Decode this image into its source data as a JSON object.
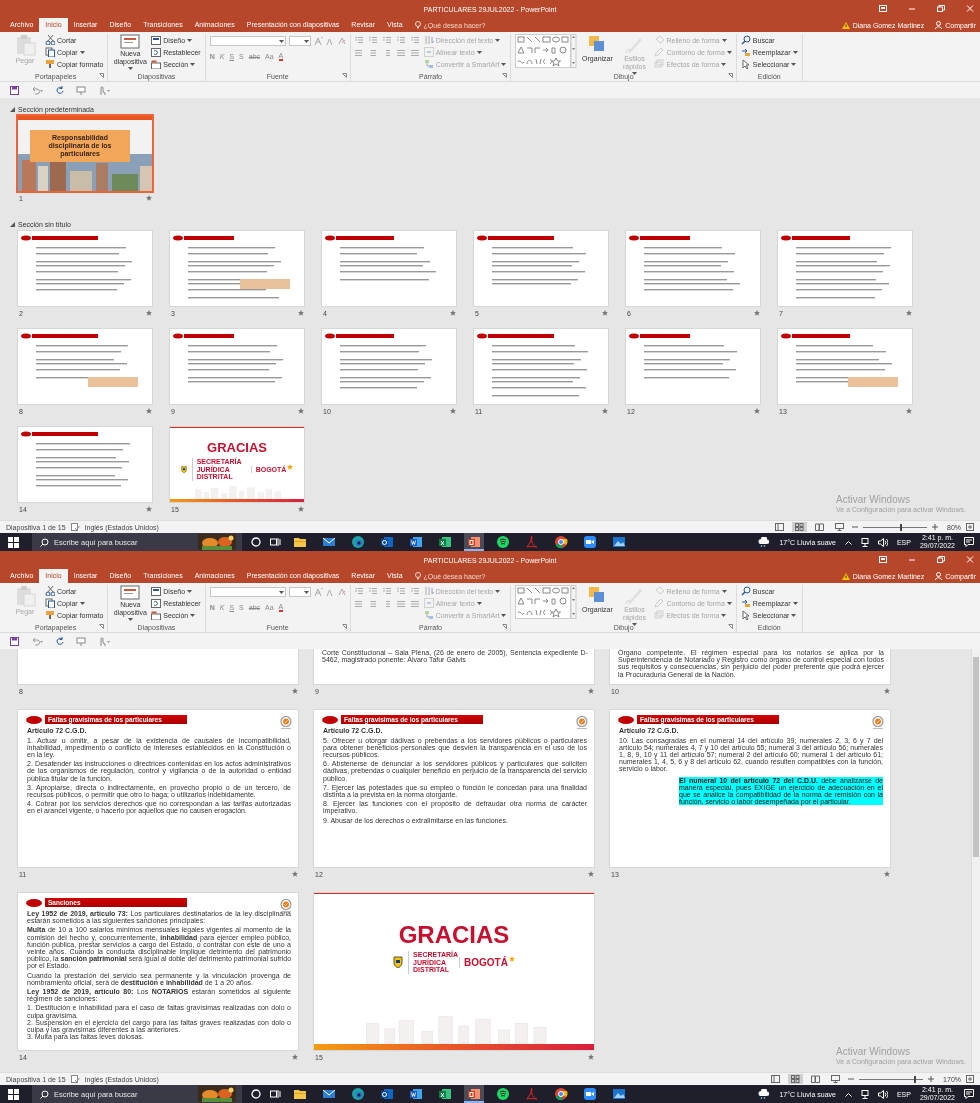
{
  "screens": [
    {
      "window": {
        "title": "PARTICULARES 29JUL2022 - PowerPoint",
        "tabs": [
          {
            "label": "Archivo",
            "selected": false
          },
          {
            "label": "Inicio",
            "selected": true
          },
          {
            "label": "Insertar",
            "selected": false
          },
          {
            "label": "Diseño",
            "selected": false
          },
          {
            "label": "Transiciones",
            "selected": false
          },
          {
            "label": "Animaciones",
            "selected": false
          },
          {
            "label": "Presentación con diapositivas",
            "selected": false
          },
          {
            "label": "Revisar",
            "selected": false
          },
          {
            "label": "Vista",
            "selected": false
          }
        ],
        "tell_me": {
          "placeholder": "¿Qué desea hacer?"
        },
        "user": "Diana Gomez Martinez",
        "share": "Compartir",
        "ribbon": [
          {
            "label": "Portapapeles",
            "launcher": true,
            "items": [
              {
                "kind": "large",
                "label": "Pegar",
                "disabled": true,
                "menu": false
              },
              {
                "kind": "small",
                "label": "Cortar",
                "disabled": false,
                "menu": false
              },
              {
                "kind": "small",
                "label": "Copiar",
                "disabled": false,
                "menu": true
              },
              {
                "kind": "small",
                "label": "Copiar formato",
                "disabled": false,
                "menu": false
              }
            ]
          },
          {
            "label": "Diapositivas",
            "launcher": false,
            "items": [
              {
                "kind": "large",
                "label": "Nueva diapositiva",
                "disabled": false,
                "menu": true
              },
              {
                "kind": "small",
                "label": "Diseño",
                "disabled": false,
                "menu": true
              },
              {
                "kind": "small",
                "label": "Restablecer",
                "disabled": false,
                "menu": false
              },
              {
                "kind": "small",
                "label": "Sección",
                "disabled": false,
                "menu": true
              }
            ]
          },
          {
            "label": "Fuente",
            "launcher": true,
            "items": [
              {
                "kind": "font-fields"
              },
              {
                "kind": "glyphs",
                "glyphs": [
                  {
                    "label": "N",
                    "disabled": true
                  },
                  {
                    "label": "K",
                    "disabled": true
                  },
                  {
                    "label": "S",
                    "disabled": true
                  },
                  {
                    "label": "S",
                    "disabled": true
                  },
                  {
                    "label": "abc",
                    "disabled": true
                  },
                  {
                    "label": "Aa",
                    "disabled": true
                  },
                  {
                    "label": "A",
                    "disabled": true
                  }
                ]
              }
            ]
          },
          {
            "label": "Párrafo",
            "launcher": true,
            "items": [
              {
                "kind": "paragraph-tools"
              },
              {
                "kind": "small",
                "label": "Dirección del texto",
                "disabled": true,
                "menu": true
              },
              {
                "kind": "small",
                "label": "Alinear texto",
                "disabled": true,
                "menu": true
              },
              {
                "kind": "small",
                "label": "Convertir a SmartArt",
                "disabled": true,
                "menu": true
              }
            ]
          },
          {
            "label": "Dibujo",
            "launcher": true,
            "items": [
              {
                "kind": "shapes"
              },
              {
                "kind": "large",
                "label": "Organizar",
                "disabled": false,
                "menu": false
              },
              {
                "kind": "large",
                "label": "Estilos rápidos",
                "disabled": true,
                "menu": true
              },
              {
                "kind": "small",
                "label": "Relleno de forma",
                "disabled": true,
                "menu": true
              },
              {
                "kind": "small",
                "label": "Contorno de forma",
                "disabled": true,
                "menu": true
              },
              {
                "kind": "small",
                "label": "Efectos de forma",
                "disabled": true,
                "menu": true
              }
            ]
          },
          {
            "label": "Edición",
            "launcher": false,
            "items": [
              {
                "kind": "small",
                "label": "Buscar",
                "disabled": false,
                "menu": false
              },
              {
                "kind": "small",
                "label": "Reemplazar",
                "disabled": false,
                "menu": true
              },
              {
                "kind": "small",
                "label": "Seleccionar",
                "disabled": false,
                "menu": true
              }
            ]
          }
        ],
        "sorter": {
          "kind": "thumbnails",
          "sections": [
            {
              "label": "Sección predeterminada",
              "expanded": true,
              "slides": [
                {
                  "number": "1",
                  "kind": "title",
                  "selected": true,
                  "title": "Responsabilidad disciplinaria de los particulares"
                }
              ]
            },
            {
              "label": "Sección sin título",
              "expanded": true,
              "slides": [
                {
                  "number": "2",
                  "kind": "thumb",
                  "selected": false
                },
                {
                  "number": "3",
                  "kind": "thumb",
                  "selected": false
                },
                {
                  "number": "4",
                  "kind": "thumb",
                  "selected": false
                },
                {
                  "number": "5",
                  "kind": "thumb",
                  "selected": false
                },
                {
                  "number": "6",
                  "kind": "thumb",
                  "selected": false
                },
                {
                  "number": "7",
                  "kind": "thumb",
                  "selected": false
                },
                {
                  "number": "8",
                  "kind": "thumb",
                  "selected": false
                },
                {
                  "number": "9",
                  "kind": "thumb",
                  "selected": false
                },
                {
                  "number": "10",
                  "kind": "thumb",
                  "selected": false
                },
                {
                  "number": "11",
                  "kind": "thumb",
                  "selected": false
                },
                {
                  "number": "12",
                  "kind": "thumb",
                  "selected": false
                },
                {
                  "number": "13",
                  "kind": "thumb",
                  "selected": false
                },
                {
                  "number": "14",
                  "kind": "thumb",
                  "selected": false
                },
                {
                  "number": "15",
                  "kind": "thanks",
                  "selected": false,
                  "title": "GRACIAS",
                  "org": "SECRETARÍA JURÍDICA DISTRITAL",
                  "city": "BOGOTÁ"
                }
              ]
            }
          ]
        },
        "activation": {
          "title": "Activar Windows",
          "text": "Ve a Configuración para activar Windows."
        },
        "status": {
          "slide": "Diapositiva 1 de 15",
          "language": "Inglés (Estados Unidos)",
          "views": [
            {
              "selected": false
            },
            {
              "selected": true
            },
            {
              "selected": false
            },
            {
              "selected": false
            }
          ],
          "zoom_slider": {
            "level": 0.6
          },
          "zoom": "80%"
        }
      },
      "taskbar": {
        "search": {
          "placeholder": "Escribe aquí para buscar"
        },
        "apps": [
          {
            "selected": false
          },
          {
            "selected": false
          },
          {
            "selected": false
          },
          {
            "selected": false
          },
          {
            "selected": false
          },
          {
            "selected": false
          },
          {
            "selected": true
          },
          {
            "selected": false
          },
          {
            "selected": false
          },
          {
            "selected": false
          },
          {
            "selected": false
          },
          {
            "selected": false
          }
        ],
        "weather": "17°C Lluvia suave",
        "lang": "ESP",
        "time": "2:41 p. m.",
        "date": "29/07/2022"
      }
    },
    {
      "window": {
        "title": "PARTICULARES 29JUL2022 - PowerPoint",
        "tabs": [
          {
            "label": "Archivo",
            "selected": false
          },
          {
            "label": "Inicio",
            "selected": true
          },
          {
            "label": "Insertar",
            "selected": false
          },
          {
            "label": "Diseño",
            "selected": false
          },
          {
            "label": "Transiciones",
            "selected": false
          },
          {
            "label": "Animaciones",
            "selected": false
          },
          {
            "label": "Presentación con diapositivas",
            "selected": false
          },
          {
            "label": "Revisar",
            "selected": false
          },
          {
            "label": "Vista",
            "selected": false
          }
        ],
        "tell_me": {
          "placeholder": "¿Qué desea hacer?"
        },
        "user": "Diana Gomez Martinez",
        "share": "Compartir",
        "ribbon": [
          {
            "label": "Portapapeles",
            "launcher": true,
            "items": [
              {
                "kind": "large",
                "label": "Pegar",
                "disabled": true,
                "menu": false
              },
              {
                "kind": "small",
                "label": "Cortar",
                "disabled": false,
                "menu": false
              },
              {
                "kind": "small",
                "label": "Copiar",
                "disabled": false,
                "menu": true
              },
              {
                "kind": "small",
                "label": "Copiar formato",
                "disabled": false,
                "menu": false
              }
            ]
          },
          {
            "label": "Diapositivas",
            "launcher": false,
            "items": [
              {
                "kind": "large",
                "label": "Nueva diapositiva",
                "disabled": false,
                "menu": true
              },
              {
                "kind": "small",
                "label": "Diseño",
                "disabled": false,
                "menu": true
              },
              {
                "kind": "small",
                "label": "Restablecer",
                "disabled": false,
                "menu": false
              },
              {
                "kind": "small",
                "label": "Sección",
                "disabled": false,
                "menu": true
              }
            ]
          },
          {
            "label": "Fuente",
            "launcher": true,
            "items": [
              {
                "kind": "font-fields"
              },
              {
                "kind": "glyphs",
                "glyphs": [
                  {
                    "label": "N",
                    "disabled": true
                  },
                  {
                    "label": "K",
                    "disabled": true
                  },
                  {
                    "label": "S",
                    "disabled": true
                  },
                  {
                    "label": "S",
                    "disabled": true
                  },
                  {
                    "label": "abc",
                    "disabled": true
                  },
                  {
                    "label": "Aa",
                    "disabled": true
                  },
                  {
                    "label": "A",
                    "disabled": true
                  }
                ]
              }
            ]
          },
          {
            "label": "Párrafo",
            "launcher": true,
            "items": [
              {
                "kind": "paragraph-tools"
              },
              {
                "kind": "small",
                "label": "Dirección del texto",
                "disabled": true,
                "menu": true
              },
              {
                "kind": "small",
                "label": "Alinear texto",
                "disabled": true,
                "menu": true
              },
              {
                "kind": "small",
                "label": "Convertir a SmartArt",
                "disabled": true,
                "menu": true
              }
            ]
          },
          {
            "label": "Dibujo",
            "launcher": true,
            "items": [
              {
                "kind": "shapes"
              },
              {
                "kind": "large",
                "label": "Organizar",
                "disabled": false,
                "menu": false
              },
              {
                "kind": "large",
                "label": "Estilos rápidos",
                "disabled": true,
                "menu": true
              },
              {
                "kind": "small",
                "label": "Relleno de forma",
                "disabled": true,
                "menu": true
              },
              {
                "kind": "small",
                "label": "Contorno de forma",
                "disabled": true,
                "menu": true
              },
              {
                "kind": "small",
                "label": "Efectos de forma",
                "disabled": true,
                "menu": true
              }
            ]
          },
          {
            "label": "Edición",
            "launcher": false,
            "items": [
              {
                "kind": "small",
                "label": "Buscar",
                "disabled": false,
                "menu": false
              },
              {
                "kind": "small",
                "label": "Reemplazar",
                "disabled": false,
                "menu": true
              },
              {
                "kind": "small",
                "label": "Seleccionar",
                "disabled": false,
                "menu": true
              }
            ]
          }
        ],
        "sorter": {
          "kind": "large",
          "slides": [
            {
              "number": "8",
              "kind": "fragment",
              "selected": false
            },
            {
              "number": "9",
              "kind": "fragment",
              "selected": false,
              "text": "Corte Constitucional – Sala Plena, (26 de enero de 2005), Sentencia expediente D-5462, magistrado ponente: Álvaro Tafur Galvis"
            },
            {
              "number": "10",
              "kind": "fragment",
              "selected": false,
              "text": "Órgano competente. El régimen especial para los notarios se aplica por la Superintendencia de Notariado y Registro como órgano de control especial con todos sus requisitos y consecuencias, sin perjuicio del poder preferente que podrá ejercer la Procuraduría General de la Nación."
            },
            {
              "number": "11",
              "kind": "content",
              "selected": false,
              "title": "Faltas gravísimas de los particulares",
              "heading": "Artículo 72 C.G.D.",
              "paragraphs": [
                {
                  "kind": "text",
                  "text": "1. Actuar u omitir, a pesar de la existencia de causales de incompatibilidad, inhabilidad, impedimento o conflicto de intereses establecidos en la Constitución o en la ley."
                },
                {
                  "kind": "text",
                  "text": "2. Desatender las instrucciones o directrices contenidas en los actos administrativos de los organismos de regulación, control y vigilancia o de la autoridad o entidad pública titular de la función."
                },
                {
                  "kind": "text",
                  "text": "3. Apropiarse, directa o indirectamente, en provecho propio o de un tercero, de recursos públicos, o permitir que otro lo haga; o utilizarlos indebidamente."
                },
                {
                  "kind": "text",
                  "text": "4. Cobrar por los servicios derechos que no correspondan a las tarifas autorizadas en el arancel vigente, o hacerlo por aquellos que no causen erogación."
                }
              ]
            },
            {
              "number": "12",
              "kind": "content",
              "selected": false,
              "title": "Faltas gravísimas de los particulares",
              "heading": "Artículo 72 C.G.D.",
              "paragraphs": [
                {
                  "kind": "text",
                  "text": "5. Ofrecer u otorgar dádivas o prebendas a los servidores públicos o particulares para obtener beneficios personales que desvíen la transparencia en el uso de los recursos públicos."
                },
                {
                  "kind": "text",
                  "text": "6. Abstenerse de denunciar a los servidores públicos y particulares que soliciten dádivas, prebendas o cualquier beneficio en perjuicio de la transparencia del servicio público."
                },
                {
                  "kind": "text",
                  "text": "7. Ejercer las potestades que su empleo o función le concedan para una finalidad distinta a la prevista en la norma otorgante."
                },
                {
                  "kind": "text",
                  "text": "8. Ejercer las funciones con el propósito de defraudar otra norma de carácter imperativo."
                },
                {
                  "kind": "text",
                  "text": "9. Abusar de los derechos o extralimitarse en las funciones."
                }
              ]
            },
            {
              "number": "13",
              "kind": "content",
              "selected": false,
              "title": "Faltas gravísimas de los particulares",
              "heading": "Artículo 72 C.G.D.",
              "paragraphs": [
                {
                  "kind": "text",
                  "text": "10. Las consagradas en el numeral 14 del artículo 39; numerales 2, 3, 6 y 7 del artículo 54; numerales 4, 7 y 10 del artículo 55; numeral 3 del artículo 56; numerales 1, 8, 9, 10 y 11 del artículo 57; numeral 2 del artículo 60; numeral 1 del artículo 61; numerales 1, 4, 5, 6 y 8 del artículo 62, cuando resulten compatibles con la función, servicio o labor."
                },
                {
                  "kind": "note",
                  "text": "**El numeral 10 del artículo 72 del C.D.U.** debe analizarse de manera especial, pues EXIGE un ejercicio de adecuación en el que se analice la compatibilidad de la norma de remisión con la función, servicio o labor desempeñada por el particular."
                }
              ]
            },
            {
              "number": "14",
              "kind": "content",
              "selected": false,
              "title": "Sanciones",
              "paragraphs": [
                {
                  "kind": "text",
                  "text": "**Ley 1952 de 2019, artículo 73:** Los particulares destinatarios de la ley disciplinaria estarán sometidos a las siguientes sanciones principales:"
                },
                {
                  "kind": "text",
                  "text": "**Multa** de 10 a 100 salarios mínimos mensuales legales vigentes al momento de la comisión del hecho y, concurrentemente, **inhabilidad** para ejercer empleo público, función pública, prestar servicios a cargo del Estado, o contratar con este de uno a veinte años. Cuando la conducta disciplinable implique detrimento del patrimonio público, la **sanción patrimonial** será igual al doble del detrimento patrimonial sufrido por el Estado."
                },
                {
                  "kind": "text",
                  "text": "Cuando la prestación del servicio sea permanente y la vinculación provenga de nombramiento oficial, será de **destitución e inhabilidad** de 1 a 20 años."
                },
                {
                  "kind": "text",
                  "text": "**Ley 1952 de 2019, artículo 80:** Los **NOTARIOS** estarán sometidos al siguiente régimen de sanciones:"
                },
                {
                  "kind": "list",
                  "text": "1. Destitución e inhabilidad para el caso de faltas gravísimas realizadas con dolo o culpa gravísima."
                },
                {
                  "kind": "list",
                  "text": "2. Suspensión en el ejercicio del cargo para las faltas graves realizadas con dolo o culpa y las gravísimas diferentes a las anteriores."
                },
                {
                  "kind": "list",
                  "text": "3. Multa para las faltas leves dolosas."
                }
              ]
            },
            {
              "number": "15",
              "kind": "thanks",
              "selected": false,
              "title": "GRACIAS",
              "org": "SECRETARÍA JURÍDICA DISTRITAL",
              "city": "BOGOTÁ"
            }
          ]
        },
        "activation": {
          "title": "Activar Windows",
          "text": "Ve a Configuración para activar Windows."
        },
        "status": {
          "slide": "Diapositiva 1 de 15",
          "language": "Inglés (Estados Unidos)",
          "views": [
            {
              "selected": false
            },
            {
              "selected": true
            },
            {
              "selected": false
            },
            {
              "selected": false
            }
          ],
          "zoom_slider": {
            "level": 0.88
          },
          "zoom": "170%"
        }
      },
      "taskbar": {
        "search": {
          "placeholder": "Escribe aquí para buscar"
        },
        "apps": [
          {
            "selected": false
          },
          {
            "selected": false
          },
          {
            "selected": false
          },
          {
            "selected": false
          },
          {
            "selected": false
          },
          {
            "selected": false
          },
          {
            "selected": true
          },
          {
            "selected": false
          },
          {
            "selected": false
          },
          {
            "selected": false
          },
          {
            "selected": false
          },
          {
            "selected": false
          }
        ],
        "weather": "17°C Lluvia suave",
        "lang": "ESP",
        "time": "2:41 p. m.",
        "date": "29/07/2022"
      }
    }
  ]
}
